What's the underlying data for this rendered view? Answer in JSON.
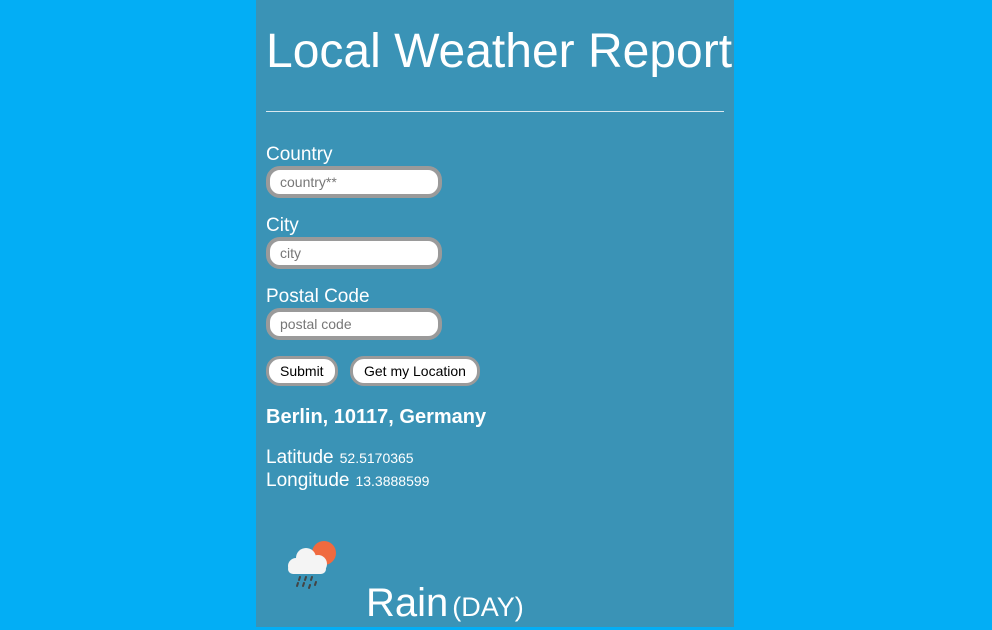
{
  "header": {
    "title": "Local Weather Report"
  },
  "form": {
    "country": {
      "label": "Country",
      "placeholder": "country**"
    },
    "city": {
      "label": "City",
      "placeholder": "city"
    },
    "postal": {
      "label": "Postal Code",
      "placeholder": "postal code"
    },
    "submit_label": "Submit",
    "locate_label": "Get my Location"
  },
  "location": {
    "place": "Berlin, 10117, Germany",
    "latitude_label": "Latitude",
    "latitude": "52.5170365",
    "longitude_label": "Longitude",
    "longitude": "13.3888599"
  },
  "weather": {
    "icon": "rain-cloud-sun-icon",
    "condition": "Rain",
    "period": "(DAY)"
  },
  "colors": {
    "background": "#03aef5",
    "panel": "#3a93b6",
    "sun": "#f06a3f"
  }
}
